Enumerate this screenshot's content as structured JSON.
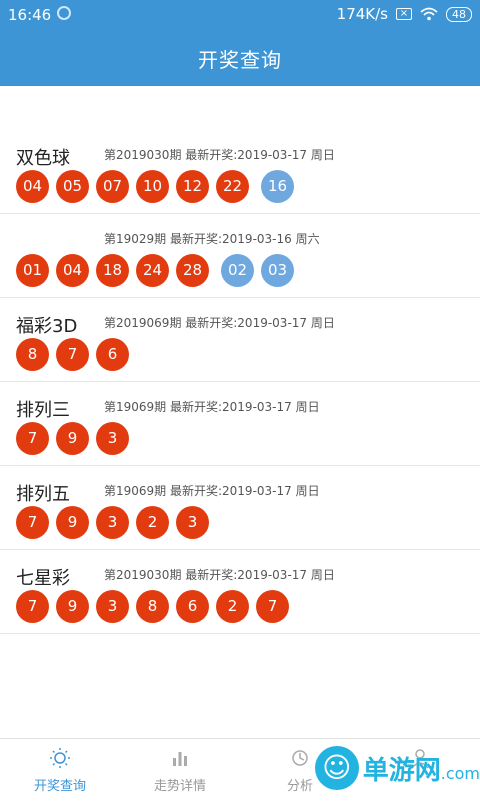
{
  "status": {
    "time": "16:46",
    "speed": "174K/s",
    "battery": "48"
  },
  "header": {
    "title": "开奖查询"
  },
  "rows": [
    {
      "name": "双色球",
      "meta": "第2019030期 最新开奖:2019-03-17 周日",
      "red": [
        "04",
        "05",
        "07",
        "10",
        "12",
        "22"
      ],
      "blue": [
        "16"
      ]
    },
    {
      "name": "",
      "meta": "第19029期 最新开奖:2019-03-16 周六",
      "red": [
        "01",
        "04",
        "18",
        "24",
        "28"
      ],
      "blue": [
        "02",
        "03"
      ]
    },
    {
      "name": "福彩3D",
      "meta": "第2019069期 最新开奖:2019-03-17 周日",
      "red": [
        "8",
        "7",
        "6"
      ],
      "blue": []
    },
    {
      "name": "排列三",
      "meta": "第19069期 最新开奖:2019-03-17 周日",
      "red": [
        "7",
        "9",
        "3"
      ],
      "blue": []
    },
    {
      "name": "排列五",
      "meta": "第19069期 最新开奖:2019-03-17 周日",
      "red": [
        "7",
        "9",
        "3",
        "2",
        "3"
      ],
      "blue": []
    },
    {
      "name": "七星彩",
      "meta": "第2019030期 最新开奖:2019-03-17 周日",
      "red": [
        "7",
        "9",
        "3",
        "8",
        "6",
        "2",
        "7"
      ],
      "blue": []
    }
  ],
  "tabs": [
    {
      "label": "开奖查询",
      "icon": "sun-icon",
      "active": true
    },
    {
      "label": "走势详情",
      "icon": "bar-chart-icon",
      "active": false
    },
    {
      "label": "分析",
      "icon": "analysis-icon",
      "active": false
    },
    {
      "label": "",
      "icon": "user-icon",
      "active": false
    }
  ],
  "watermark": {
    "text": "单游网",
    "suffix": ".com"
  },
  "colors": {
    "primary": "#3d95d5",
    "red_ball": "#e23b0f",
    "blue_ball": "#6fa8de"
  }
}
